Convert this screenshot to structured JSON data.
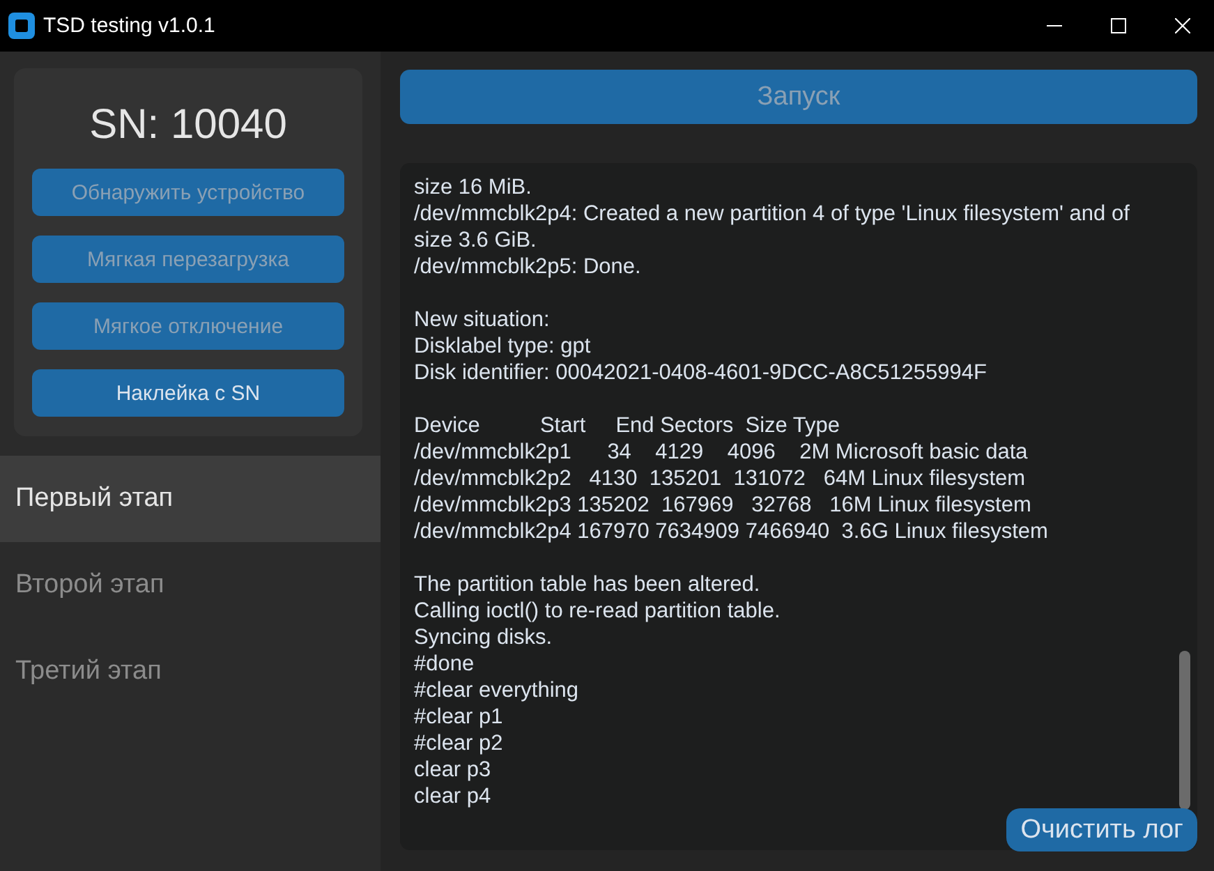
{
  "window": {
    "title": "TSD testing v1.0.1"
  },
  "device_card": {
    "serial": "SN: 10040",
    "buttons": [
      {
        "label": "Обнаружить устройство",
        "disabled": true
      },
      {
        "label": "Мягкая перезагрузка",
        "disabled": true
      },
      {
        "label": "Мягкое отключение",
        "disabled": true
      },
      {
        "label": "Наклейка с SN",
        "disabled": false
      }
    ]
  },
  "sidebar": {
    "items": [
      {
        "label": "Первый этап",
        "selected": true
      },
      {
        "label": "Второй этап",
        "selected": false
      },
      {
        "label": "Третий этап",
        "selected": false
      }
    ]
  },
  "launch_button": {
    "label": "Запуск",
    "disabled": true
  },
  "log": {
    "groups": [
      [
        "size 16 MiB.",
        "/dev/mmcblk2p4: Created a new partition 4 of type 'Linux filesystem' and of size 3.6 GiB.",
        "/dev/mmcblk2p5: Done."
      ],
      [
        "New situation:",
        "Disklabel type: gpt",
        "Disk identifier: 00042021-0408-4601-9DCC-A8C51255994F"
      ],
      [
        "Device          Start     End Sectors  Size Type",
        "/dev/mmcblk2p1      34    4129    4096    2M Microsoft basic data",
        "/dev/mmcblk2p2   4130  135201  131072   64M Linux filesystem",
        "/dev/mmcblk2p3 135202  167969   32768   16M Linux filesystem",
        "/dev/mmcblk2p4 167970 7634909 7466940  3.6G Linux filesystem"
      ],
      [
        "The partition table has been altered.",
        "Calling ioctl() to re-read partition table.",
        "Syncing disks.",
        "#done",
        "#clear everything",
        "#clear p1",
        "#clear p2",
        "clear p3",
        "clear p4"
      ]
    ],
    "clear_button": {
      "label": "Очистить лог"
    }
  }
}
